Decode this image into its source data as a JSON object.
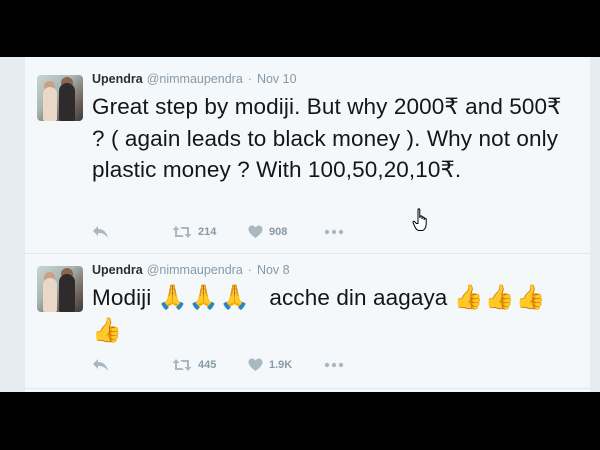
{
  "tweets": [
    {
      "author_name": "Upendra",
      "handle": "@nimmaupendra",
      "separator": "·",
      "date": "Nov 10",
      "text": "Great step by modiji. But why 2000₹ and 500₹ ?  ( again leads to black money ). Why not only plastic money ?  With 100,50,20,10₹.",
      "retweets": "214",
      "likes": "908"
    },
    {
      "author_name": "Upendra",
      "handle": "@nimmaupendra",
      "separator": "·",
      "date": "Nov 8",
      "text_start": "Modiji ",
      "emoji_pray": "🙏🙏🙏",
      "text_mid": "   acche din aagaya ",
      "emoji_thumbs": "👍👍👍👍",
      "retweets": "445",
      "likes": "1.9K"
    }
  ],
  "icons": {
    "reply": "reply-icon",
    "retweet": "retweet-icon",
    "like": "heart-icon",
    "more": "more-dots-icon",
    "cursor": "hand-cursor-icon"
  },
  "colors": {
    "page_bg": "#e6ecf0",
    "tweet_bg": "#f5f8fa",
    "text": "#14171a",
    "muted": "#8899a6"
  }
}
